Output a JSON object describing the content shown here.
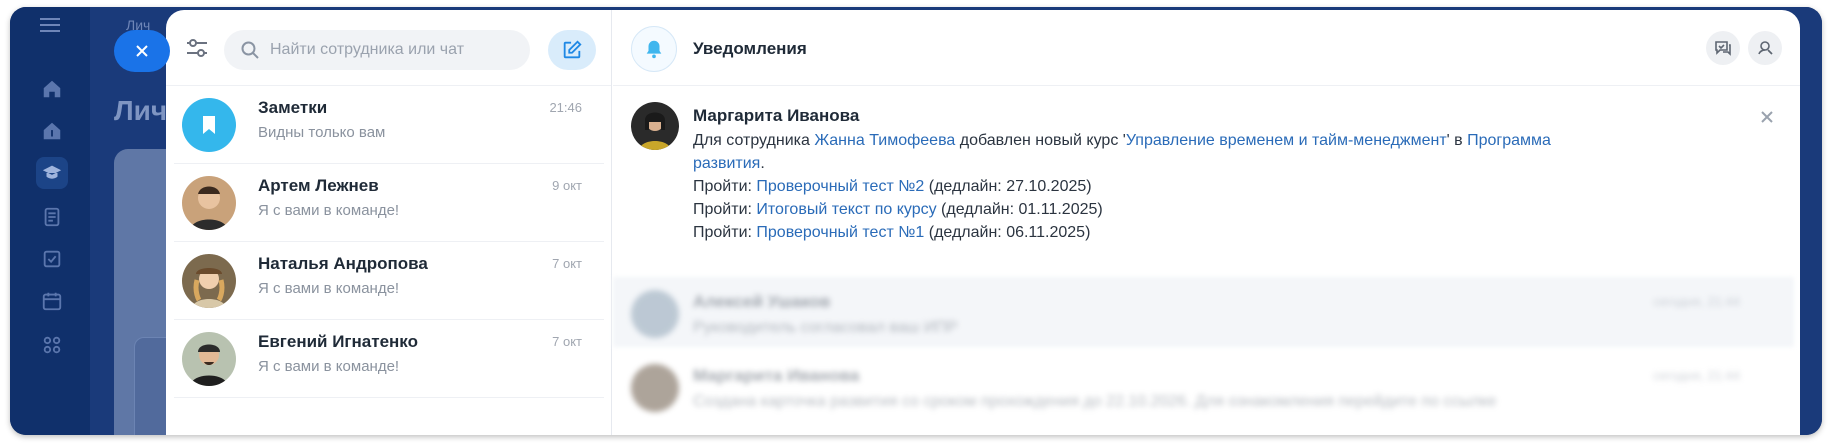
{
  "background": {
    "breadcrumb": "Лич",
    "title": "Лич"
  },
  "search": {
    "placeholder": "Найти сотрудника или чат"
  },
  "chats": [
    {
      "name": "Заметки",
      "time": "21:46",
      "preview": "Видны только вам",
      "avatar": "bookmark-icon"
    },
    {
      "name": "Артем Лежнев",
      "time": "9 окт",
      "preview": "Я с вами в команде!"
    },
    {
      "name": "Наталья Андропова",
      "time": "7 окт",
      "preview": "Я с вами в команде!"
    },
    {
      "name": "Евгений Игнатенко",
      "time": "7 окт",
      "preview": "Я с вами в команде!"
    }
  ],
  "notifications_header": {
    "title": "Уведомления"
  },
  "notification": {
    "author": "Маргарита Иванова",
    "line1_prefix": "Для сотрудника ",
    "employee": "Жанна Тимофеева",
    "line1_mid": " добавлен новый курс '",
    "course": "Управление временем и тайм-менеджмент",
    "line1_mid2": "' в ",
    "program": "Программа развития",
    "line1_end": ".",
    "tasks": [
      {
        "prefix": "Пройти: ",
        "link": "Проверочный тест №2",
        "deadline": " (дедлайн: 27.10.2025)"
      },
      {
        "prefix": "Пройти: ",
        "link": "Итоговый текст по курсу",
        "deadline": " (дедлайн: 01.11.2025)"
      },
      {
        "prefix": "Пройти: ",
        "link": "Проверочный тест №1",
        "deadline": " (дедлайн: 06.11.2025)"
      }
    ]
  },
  "blurred": [
    {
      "author": "Алексей Ушаков",
      "date": "сегодня, 21:44",
      "text": "Руководитель согласовал ваш ИПР"
    },
    {
      "author": "Маргарита Иванова",
      "date": "сегодня, 21:44",
      "text": "Создана карточка развития со сроком прохождения до 22.10.2026. Для ознакомления перейдите по ссылке ",
      "link": "ссылке"
    }
  ]
}
